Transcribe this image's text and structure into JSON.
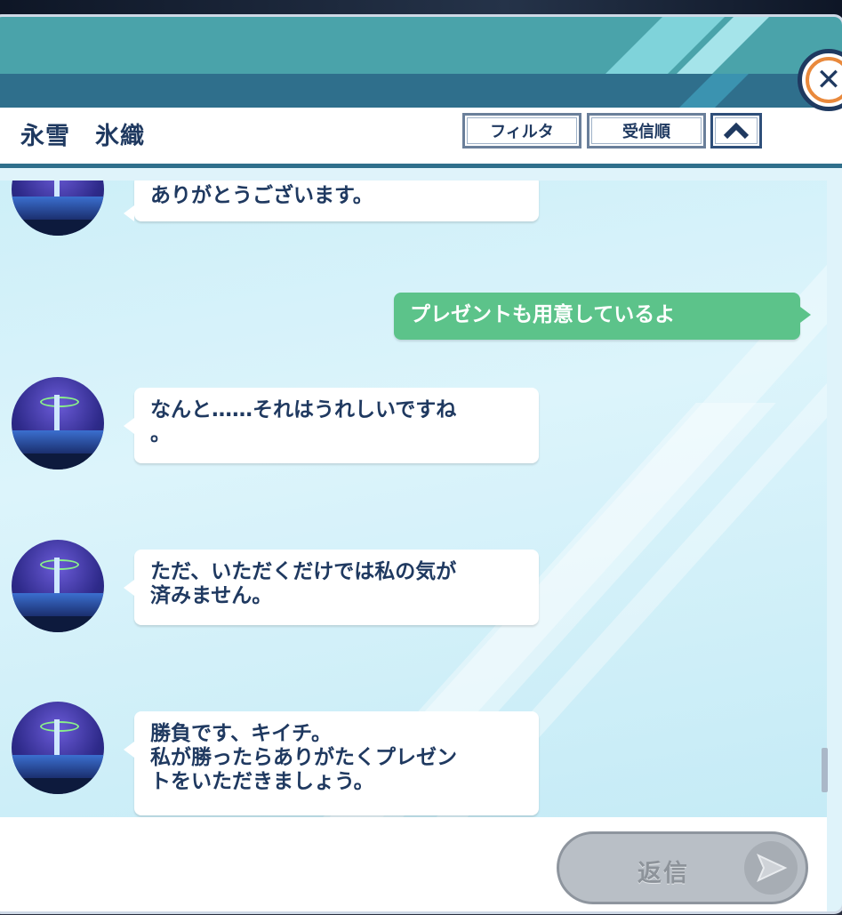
{
  "header": {
    "contact_name": "永雪　氷織",
    "filter_label": "フィルタ",
    "sort_label": "受信順",
    "collapse_icon": "chevron-up-icon",
    "close_icon": "close-icon"
  },
  "messages": [
    {
      "direction": "incoming",
      "lines": [
        "ありがとうございます。"
      ]
    },
    {
      "direction": "outgoing",
      "lines": [
        "プレゼントも用意しているよ"
      ]
    },
    {
      "direction": "incoming",
      "lines": [
        "なんと……それはうれしいですね",
        "。"
      ]
    },
    {
      "direction": "incoming",
      "lines": [
        "ただ、いただくだけでは私の気が",
        "済みません。"
      ]
    },
    {
      "direction": "incoming",
      "lines": [
        "勝負です、キイチ。",
        "私が勝ったらありがたくプレゼン",
        "トをいただきましょう。"
      ]
    }
  ],
  "footer": {
    "reply_label": "返信",
    "send_icon": "send-arrow-icon"
  },
  "colors": {
    "accent_teal": "#4aa3aa",
    "navy": "#1f3960",
    "outgoing_bubble": "#5cc38a",
    "close_ring": "#e9893c"
  }
}
